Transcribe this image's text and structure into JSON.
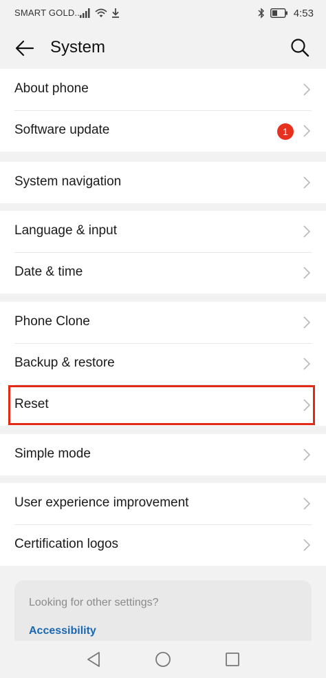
{
  "status_bar": {
    "carrier": "SMART GOLD...",
    "time": "4:53"
  },
  "header": {
    "title": "System"
  },
  "groups": [
    {
      "items": [
        {
          "label": "About phone"
        },
        {
          "label": "Software update",
          "badge": "1"
        }
      ]
    },
    {
      "items": [
        {
          "label": "System navigation"
        }
      ]
    },
    {
      "items": [
        {
          "label": "Language & input"
        },
        {
          "label": "Date & time"
        }
      ]
    },
    {
      "items": [
        {
          "label": "Phone Clone"
        },
        {
          "label": "Backup & restore"
        },
        {
          "label": "Reset"
        }
      ]
    },
    {
      "items": [
        {
          "label": "Simple mode"
        }
      ]
    },
    {
      "items": [
        {
          "label": "User experience improvement"
        },
        {
          "label": "Certification logos"
        }
      ]
    }
  ],
  "suggestions": {
    "title": "Looking for other settings?",
    "link": "Accessibility"
  },
  "highlight_color": "#e22a17",
  "badge_color": "#e8301e",
  "link_color": "#1867b0",
  "icons": {
    "back": "arrow-left-icon",
    "search": "search-icon",
    "chevron": "chevron-right-icon",
    "nav_back": "triangle-back-icon",
    "nav_home": "circle-home-icon",
    "nav_recents": "square-recents-icon"
  }
}
